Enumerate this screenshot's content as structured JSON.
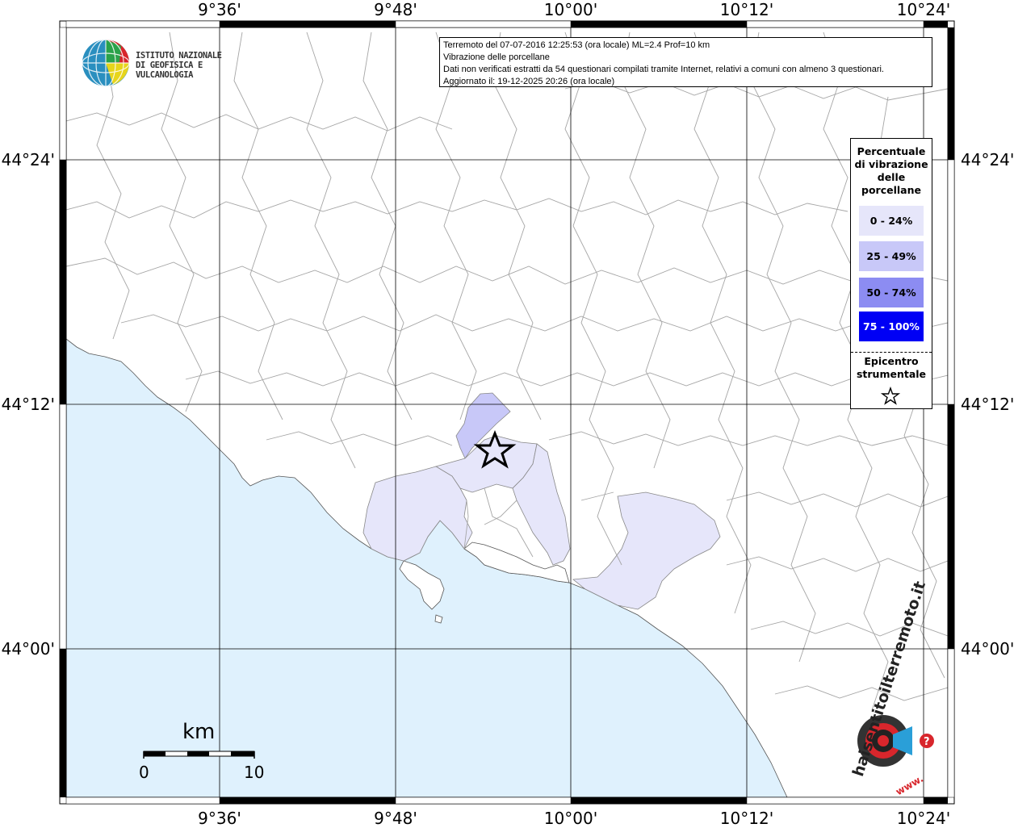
{
  "map": {
    "colors": {
      "sea": "#dff1fd",
      "land": "#ffffff",
      "border": "#a5a5a5",
      "grid": "#000000",
      "class_0_24": "#e6e6fa",
      "class_25_49": "#c8c8f8",
      "class_50_74": "#8c8cf2",
      "class_75_100": "#0000f5"
    },
    "lon_ticks_top": [
      "9°36'",
      "9°48'",
      "10°00'",
      "10°12'",
      "10°24'"
    ],
    "lon_ticks_bottom": [
      "9°36'",
      "9°48'",
      "10°00'",
      "10°12'",
      "10°24'"
    ],
    "lat_ticks_left": [
      "44°24'",
      "44°12'",
      "44°00'"
    ],
    "lat_ticks_right": [
      "44°24'",
      "44°12'",
      "44°00'"
    ]
  },
  "info": {
    "line1": "Terremoto del 07-07-2016 12:25:53 (ora locale) ML=2.4 Prof=10 km",
    "line2": "Vibrazione delle porcellane",
    "line3": "Dati non verificati estratti da 54 questionari compilati tramite Internet, relativi a comuni con almeno 3 questionari.",
    "line4": "Aggiornato il: 19-12-2025 20:26 (ora locale)"
  },
  "legend": {
    "title_lines": [
      "Percentuale",
      "di vibrazione",
      "delle",
      "porcellane"
    ],
    "classes": [
      "0 - 24%",
      "25 - 49%",
      "50 - 74%",
      "75 - 100%"
    ],
    "epicenter_lines": [
      "Epicentro",
      "strumentale"
    ],
    "epicenter_icon": "star-outline-icon"
  },
  "ingv": {
    "line1": "ISTITUTO NAZIONALE",
    "line2": "DI GEOFISICA E VULCANOLOGIA",
    "icon": "globe-icon"
  },
  "scale": {
    "unit": "km",
    "min": "0",
    "max": "10"
  },
  "hsit": {
    "text": "haisentitoilterremoto.it",
    "www": "www.",
    "icon": "target-megaphone-icon"
  }
}
